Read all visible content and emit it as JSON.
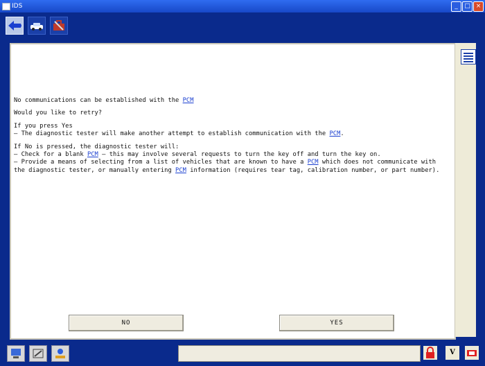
{
  "window": {
    "title": "IDS",
    "minimize": "_",
    "maximize": "□",
    "close": "×"
  },
  "tabs": [
    {
      "icon": "arrow-left-icon",
      "active": true
    },
    {
      "icon": "car-icon",
      "active": false
    },
    {
      "icon": "toolbox-icon",
      "active": false
    }
  ],
  "sidebar": {
    "menu_icon": "list-menu-icon"
  },
  "content": {
    "intro_text": "No communications can be established with the",
    "pcm": "PCM",
    "question": "Would you like to retry?",
    "yes_header": "If you press Yes",
    "yes_line_prefix": " –  The diagnostic tester will make another attempt to establish communication with the",
    "no_header": "If No is pressed, the diagnostic tester will:",
    "no_line1_prefix": " –  Check for a blank",
    "no_line1_suffix": " – this may involve several requests to turn the key off and turn the key on.",
    "no_line2_prefix": " –  Provide a means of selecting from a list of vehicles that are known to have a",
    "no_line2_middle": " which does not communicate with the diagnostic tester, or manually entering",
    "no_line2_suffix": " information (requires tear tag, calibration number, or part number)."
  },
  "buttons": {
    "no_label": "NO",
    "yes_label": "YES"
  },
  "statusbar": {
    "left_icons": [
      "computer-icon",
      "toolbox-window-icon",
      "user-tools-icon"
    ],
    "status_text": "",
    "right_icons": [
      "lock-icon",
      "vehicle-voltage-icon",
      "battery-icon"
    ],
    "voltage_label": "V"
  }
}
